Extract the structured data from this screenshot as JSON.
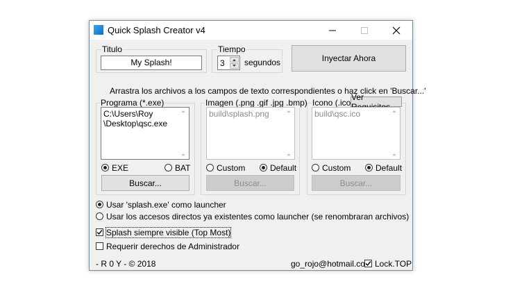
{
  "window": {
    "title": "Quick Splash Creator v4"
  },
  "titulo": {
    "label": "Titulo",
    "value": "My Splash!"
  },
  "tiempo": {
    "label": "Tiempo",
    "value": "3",
    "unit": "segundos"
  },
  "inject_button": "Inyectar Ahora",
  "instructions": "Arrastra los archivos a los campos de texto correspondientes o haz click en 'Buscar...'",
  "programa": {
    "label": "Programa (*.exe)",
    "path_lines": [
      "C:\\Users\\Roy",
      "\\Desktop\\qsc.exe"
    ],
    "radio_exe": "EXE",
    "radio_bat": "BAT",
    "buscar": "Buscar..."
  },
  "imagen": {
    "label": "Imagen (.png .gif .jpg .bmp)",
    "path": "build\\splash.png",
    "radio_custom": "Custom",
    "radio_default": "Default",
    "buscar": "Buscar..."
  },
  "icono": {
    "label": "Icono (.ico)",
    "requisitos_button": "Ver Requisitos",
    "path": "build\\qsc.ico",
    "radio_custom": "Custom",
    "radio_default": "Default",
    "buscar": "Buscar..."
  },
  "launcher": {
    "option1": "Usar 'splash.exe' como launcher",
    "option2": "Usar los accesos directos ya existentes como launcher (se renombraran archivos)"
  },
  "options": {
    "topmost": "Splash siempre visible (Top Most)",
    "admin": "Requerir derechos de Administrador"
  },
  "footer": {
    "credit": "- R 0 Y - © 2018",
    "email": "go_rojo@hotmail.com",
    "lock_top": "Lock.TOP"
  }
}
